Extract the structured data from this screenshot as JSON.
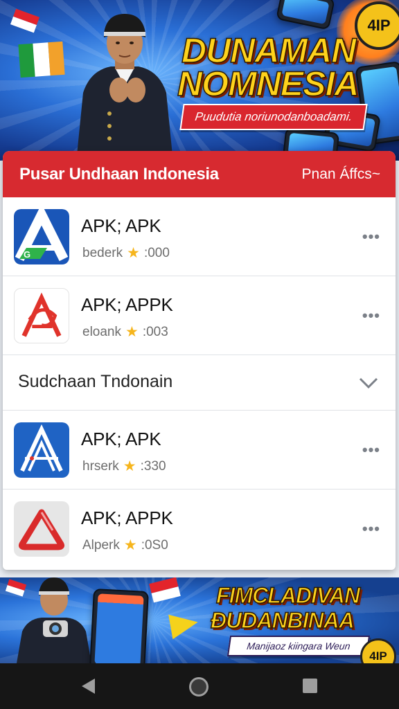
{
  "banner_top": {
    "headline_line1": "DUNAMAN",
    "headline_line2": "NOMNESIA",
    "ribbon_text": "Puudutia noriunodanboadami.",
    "badge_text": "4IP"
  },
  "header": {
    "title": "Pusar Undhaan Indonesia",
    "action": "Pnan Áffcs~"
  },
  "apps": [
    {
      "title": "APK; APK",
      "meta_label": "bederk",
      "meta_count": ":000",
      "icon": "a-letter-icon"
    },
    {
      "title": "APK; APPK",
      "meta_label": "eloank",
      "meta_count": ":003",
      "icon": "a-logo-icon"
    }
  ],
  "section": {
    "label": "Sudchaan Tndonain"
  },
  "apps_more": [
    {
      "title": "APK; APK",
      "meta_label": "hrserk",
      "meta_count": ":330",
      "icon": "a-outline-icon"
    },
    {
      "title": "APK; APPK",
      "meta_label": "Alperk",
      "meta_count": ":0S0",
      "icon": "triangle-logo-icon"
    }
  ],
  "banner_bottom": {
    "headline_line1": "FIMCLADIVAN",
    "headline_line2": "ÐUDANBINAA",
    "ribbon_text": "Manijaoz kiingara Weun",
    "badge_text": "4IP"
  },
  "colors": {
    "header_red": "#d72a30",
    "star_yellow": "#f6b51c",
    "headline_yellow": "#ffd21c"
  }
}
